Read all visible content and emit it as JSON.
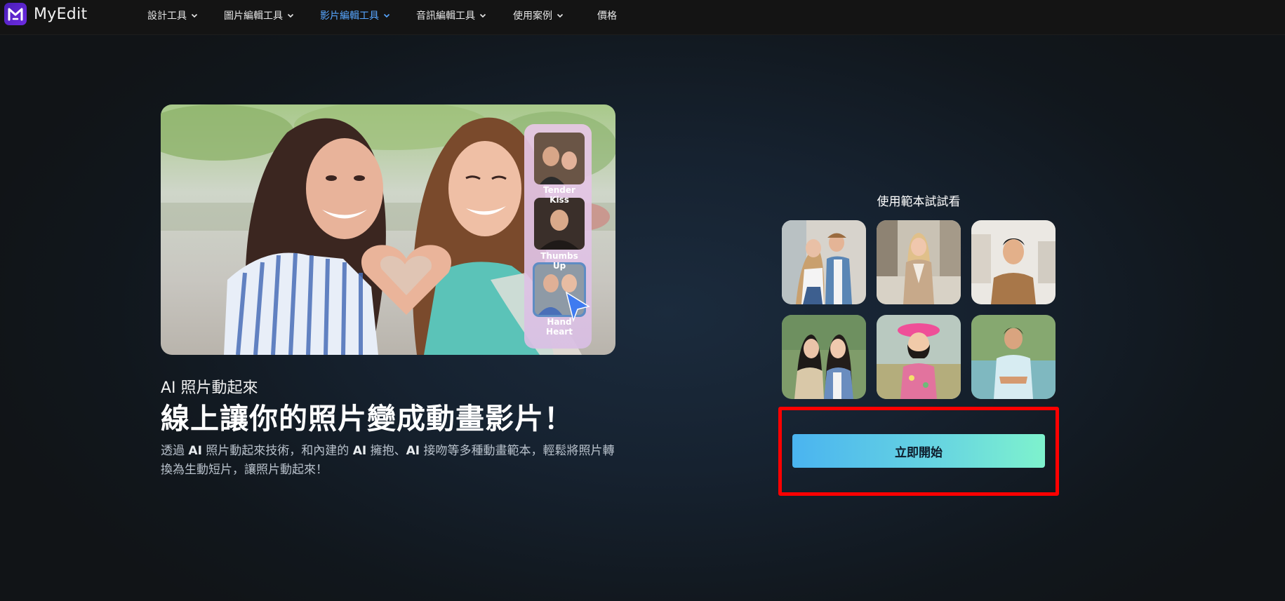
{
  "brand": {
    "name": "MyEdit",
    "accent": "#5b25cc"
  },
  "nav": {
    "items": [
      {
        "label": "設計工具",
        "has_dropdown": true,
        "active": false
      },
      {
        "label": "圖片編輯工具",
        "has_dropdown": true,
        "active": false
      },
      {
        "label": "影片編輯工具",
        "has_dropdown": true,
        "active": true
      },
      {
        "label": "音訊編輯工具",
        "has_dropdown": true,
        "active": false
      },
      {
        "label": "使用案例",
        "has_dropdown": true,
        "active": false
      },
      {
        "label": "價格",
        "has_dropdown": false,
        "active": false
      }
    ],
    "active_color": "#57a6ff"
  },
  "hero": {
    "templates": [
      {
        "label": "Tender Kiss"
      },
      {
        "label": "Thumbs Up"
      },
      {
        "label": "Hand Heart",
        "selected": true
      }
    ],
    "subtitle": "AI 照片動起來",
    "headline": "線上讓你的照片變成動畫影片！",
    "description_parts": [
      "透過 ",
      "AI",
      " 照片動起來技術，和內建的 ",
      "AI",
      " 擁抱、",
      "AI",
      " 接吻等多種動畫範本，輕鬆將照片轉換為生動短片，讓照片動起來！"
    ]
  },
  "samples": {
    "title": "使用範本試試看",
    "items": [
      {
        "name": "couple-standing"
      },
      {
        "name": "woman-city"
      },
      {
        "name": "man-room"
      },
      {
        "name": "two-women"
      },
      {
        "name": "girl-pink-hat"
      },
      {
        "name": "boy-park"
      }
    ]
  },
  "cta": {
    "label": "立即開始",
    "highlight_color": "#ff0000"
  }
}
